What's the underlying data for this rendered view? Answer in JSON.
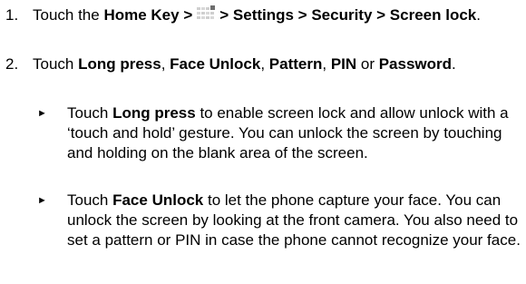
{
  "steps": [
    {
      "number": "1.",
      "text_touch": "Touch the ",
      "home_key": "Home Key >",
      "path": "> Settings > Security > Screen lock",
      "period": ".",
      "icon": "apps-grid-icon"
    },
    {
      "number": "2.",
      "text_touch": "Touch ",
      "opt1": "Long press",
      "sep1": ", ",
      "opt2": "Face Unlock",
      "sep2": ", ",
      "opt3": "Pattern",
      "sep3": ", ",
      "opt4": "PIN",
      "sep4": " or ",
      "opt5": "Password",
      "period": "."
    }
  ],
  "bullets": [
    {
      "mark": "►",
      "lead": "Touch ",
      "bold": "Long press",
      "rest": " to enable screen lock and allow unlock with a ‘touch and hold’ gesture. You can unlock the screen by touching and holding on the blank area of the screen."
    },
    {
      "mark": "►",
      "lead": "Touch ",
      "bold": "Face Unlock",
      "rest": " to let the phone capture your face. You can unlock the screen by looking at the front camera. You also need to set a pattern or PIN in case the phone cannot recognize your face."
    }
  ]
}
